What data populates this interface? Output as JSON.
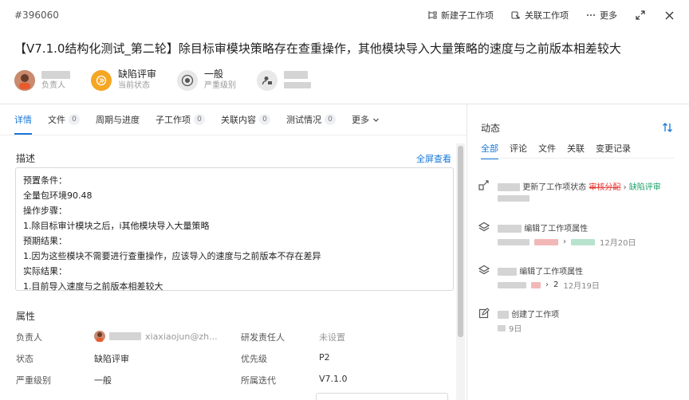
{
  "header": {
    "id": "#396060",
    "new_subitem": "新建子工作项",
    "link_item": "关联工作项",
    "more": "更多"
  },
  "title": "【V7.1.0结构化测试_第二轮】除目标审模块策略存在查重操作，其他模块导入大量策略的速度与之前版本相差较大",
  "meta": {
    "assignee_label": "负责人",
    "state_value": "缺陷评审",
    "state_label": "当前状态",
    "severity_value": "一般",
    "severity_label": "严重级别"
  },
  "tabs": [
    {
      "label": "详情",
      "count": ""
    },
    {
      "label": "文件",
      "count": "0"
    },
    {
      "label": "周期与进度",
      "count": ""
    },
    {
      "label": "子工作项",
      "count": "0"
    },
    {
      "label": "关联内容",
      "count": "0"
    },
    {
      "label": "测试情况",
      "count": "0"
    },
    {
      "label": "更多",
      "count": ""
    }
  ],
  "description": {
    "label": "描述",
    "fullscreen": "全屏查看",
    "lines": [
      "预置条件：",
      "全量包环境90.48",
      "操作步骤：",
      "1.除目标审计模块之后，i其他模块导入大量策略",
      "预期结果：",
      "1.因为这些模块不需要进行查重操作，应该导入的速度与之前版本不存在差异",
      "实际结果：",
      "1.目前导入速度与之前版本相差较大"
    ]
  },
  "properties": {
    "label": "属性",
    "assignee_key": "负责人",
    "assignee_value": "xiaxiaojun@zh...",
    "dev_owner_key": "研发责任人",
    "dev_owner_value": "未设置",
    "state_key": "状态",
    "state_value": "缺陷评审",
    "priority_key": "优先级",
    "priority_value": "P2",
    "severity_key": "严重级别",
    "severity_value": "一般",
    "iteration_key": "所属迭代",
    "iteration_value": "V7.1.0"
  },
  "activity": {
    "title": "动态",
    "tabs": [
      "全部",
      "评论",
      "文件",
      "关联",
      "变更记录"
    ],
    "a1_text": "更新了工作项状态",
    "a1_old": "审核分配",
    "a1_new": "缺陷评审",
    "a2_text": "编辑了工作项属性",
    "a2_date": "12月20日",
    "a3_text": "编辑了工作项属性",
    "a3_new": "2",
    "a3_date": "12月19日",
    "a4_text": "创建了工作项",
    "a4_date": "9日"
  }
}
